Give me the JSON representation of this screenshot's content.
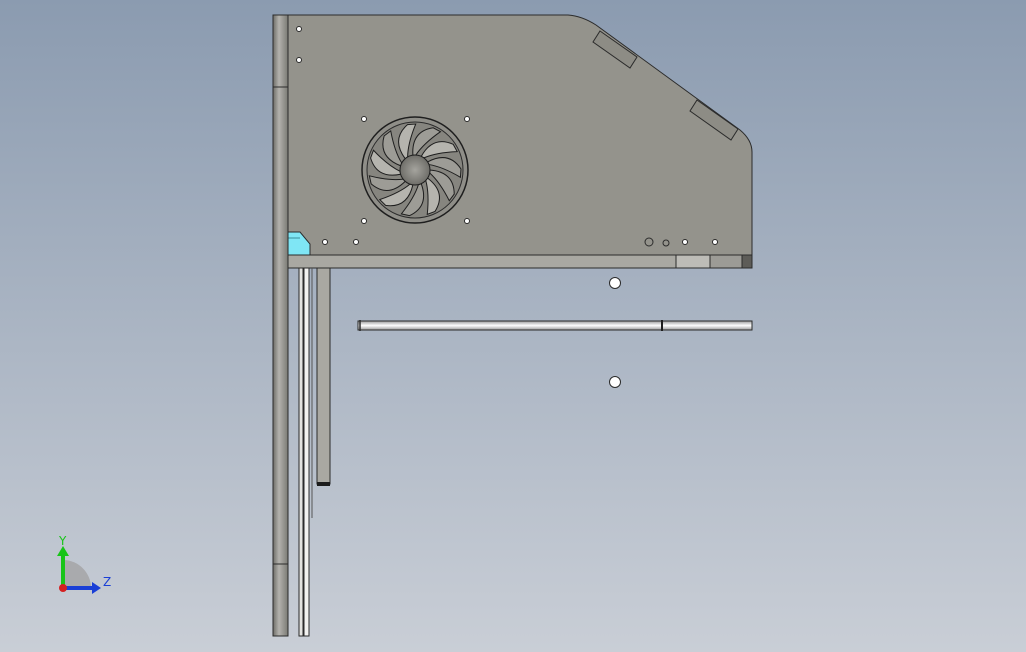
{
  "viewport": {
    "background_top": "#8b9bb0",
    "background_bottom": "#c9ced6"
  },
  "model": {
    "panel_color": "#94938c",
    "rail_color": "#a9a8a2",
    "edge_color": "#2b2b2b",
    "accent_cyan": "#7fe6f5",
    "tube_color": "#f3f3f3"
  },
  "triad": {
    "y_label": "Y",
    "z_label": "Z",
    "y_color": "#18c418",
    "z_color": "#1a3fd6",
    "x_color": "#d42020"
  }
}
